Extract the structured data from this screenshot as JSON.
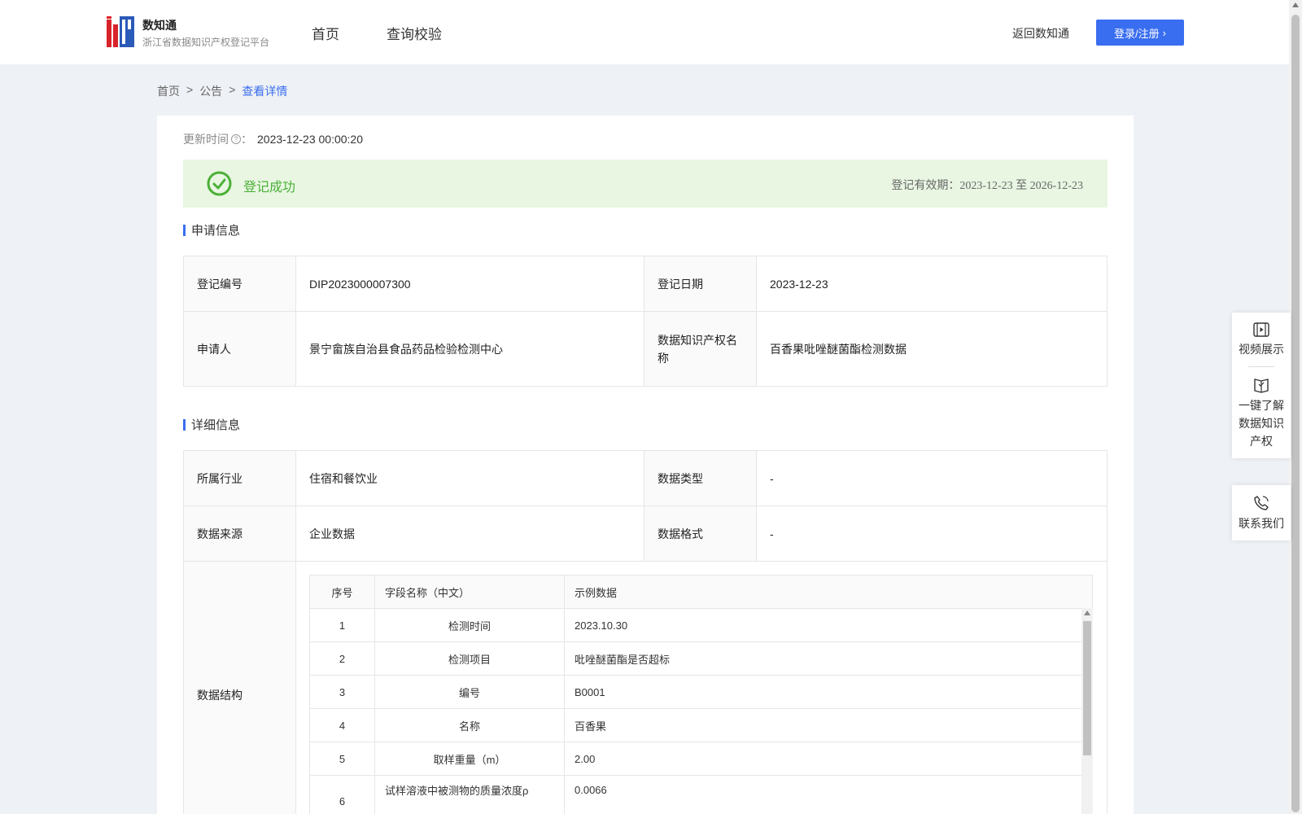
{
  "header": {
    "logo_title": "数知通",
    "logo_subtitle": "浙江省数据知识产权登记平台",
    "nav": [
      {
        "label": "首页"
      },
      {
        "label": "查询校验"
      }
    ],
    "back_link": "返回数知通",
    "login_button": "登录/注册"
  },
  "breadcrumb": {
    "items": [
      "首页",
      "公告",
      "查看详情"
    ],
    "separator": ">"
  },
  "update": {
    "label": "更新时间",
    "suffix": "：",
    "value": "2023-12-23 00:00:20"
  },
  "status": {
    "text": "登记成功",
    "validity_label": "登记有效期：",
    "validity_range": "2023-12-23 至 2026-12-23",
    "color": "#4cb037"
  },
  "apply_section": {
    "title": "申请信息",
    "rows": [
      {
        "l1": "登记编号",
        "v1": "DIP2023000007300",
        "l2": "登记日期",
        "v2": "2023-12-23"
      },
      {
        "l1": "申请人",
        "v1": "景宁畲族自治县食品药品检验检测中心",
        "l2": "数据知识产权名称",
        "v2": "百香果吡唑醚菌酯检测数据"
      }
    ]
  },
  "detail_section": {
    "title": "详细信息",
    "rows": [
      {
        "l1": "所属行业",
        "v1": "住宿和餐饮业",
        "l2": "数据类型",
        "v2": "-"
      },
      {
        "l1": "数据来源",
        "v1": "企业数据",
        "l2": "数据格式",
        "v2": "-"
      }
    ],
    "structure_label": "数据结构",
    "structure": {
      "headers": [
        "序号",
        "字段名称（中文）",
        "示例数据"
      ],
      "rows": [
        {
          "idx": "1",
          "name": "检测时间",
          "example": "2023.10.30"
        },
        {
          "idx": "2",
          "name": "检测项目",
          "example": "吡唑醚菌酯是否超标"
        },
        {
          "idx": "3",
          "name": "编号",
          "example": "B0001"
        },
        {
          "idx": "4",
          "name": "名称",
          "example": "百香果"
        },
        {
          "idx": "5",
          "name": "取样重量（m）",
          "example": "2.00"
        },
        {
          "idx": "6",
          "name": "试样溶液中被测物的质量浓度ρ",
          "example": "0.0066"
        }
      ]
    }
  },
  "float_panel": {
    "video": "视频展示",
    "learn": "一键了解数据知识产权",
    "contact": "联系我们"
  },
  "colors": {
    "accent": "#3a6ef0",
    "success": "#4cb037"
  }
}
